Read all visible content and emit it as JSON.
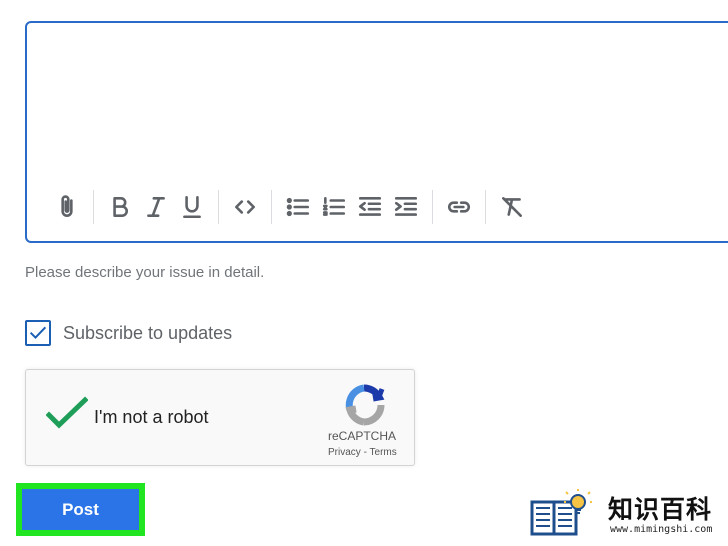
{
  "editor": {
    "toolbar": [
      {
        "name": "attach-icon",
        "label": "Attach"
      },
      {
        "name": "bold-icon",
        "label": "Bold"
      },
      {
        "name": "italic-icon",
        "label": "Italic"
      },
      {
        "name": "underline-icon",
        "label": "Underline"
      },
      {
        "name": "code-icon",
        "label": "Code"
      },
      {
        "name": "bulleted-list-icon",
        "label": "Bulleted list"
      },
      {
        "name": "numbered-list-icon",
        "label": "Numbered list"
      },
      {
        "name": "decrease-indent-icon",
        "label": "Decrease indent"
      },
      {
        "name": "increase-indent-icon",
        "label": "Increase indent"
      },
      {
        "name": "link-icon",
        "label": "Link"
      },
      {
        "name": "clear-formatting-icon",
        "label": "Clear formatting"
      }
    ]
  },
  "helper_text": "Please describe your issue in detail.",
  "subscribe": {
    "label": "Subscribe to updates",
    "checked": true
  },
  "captcha": {
    "label": "I'm not a robot",
    "brand": "reCAPTCHA",
    "privacy": "Privacy",
    "separator": " - ",
    "terms": "Terms",
    "checked": true
  },
  "post_button": {
    "label": "Post"
  },
  "colors": {
    "editor_border": "#2a6ac8",
    "post_button": "#2a74e8",
    "highlight": "#22e522",
    "checkmark": "#1e9e58"
  },
  "watermark": {
    "title": "知识百科",
    "url": "www.mimingshi.com"
  }
}
